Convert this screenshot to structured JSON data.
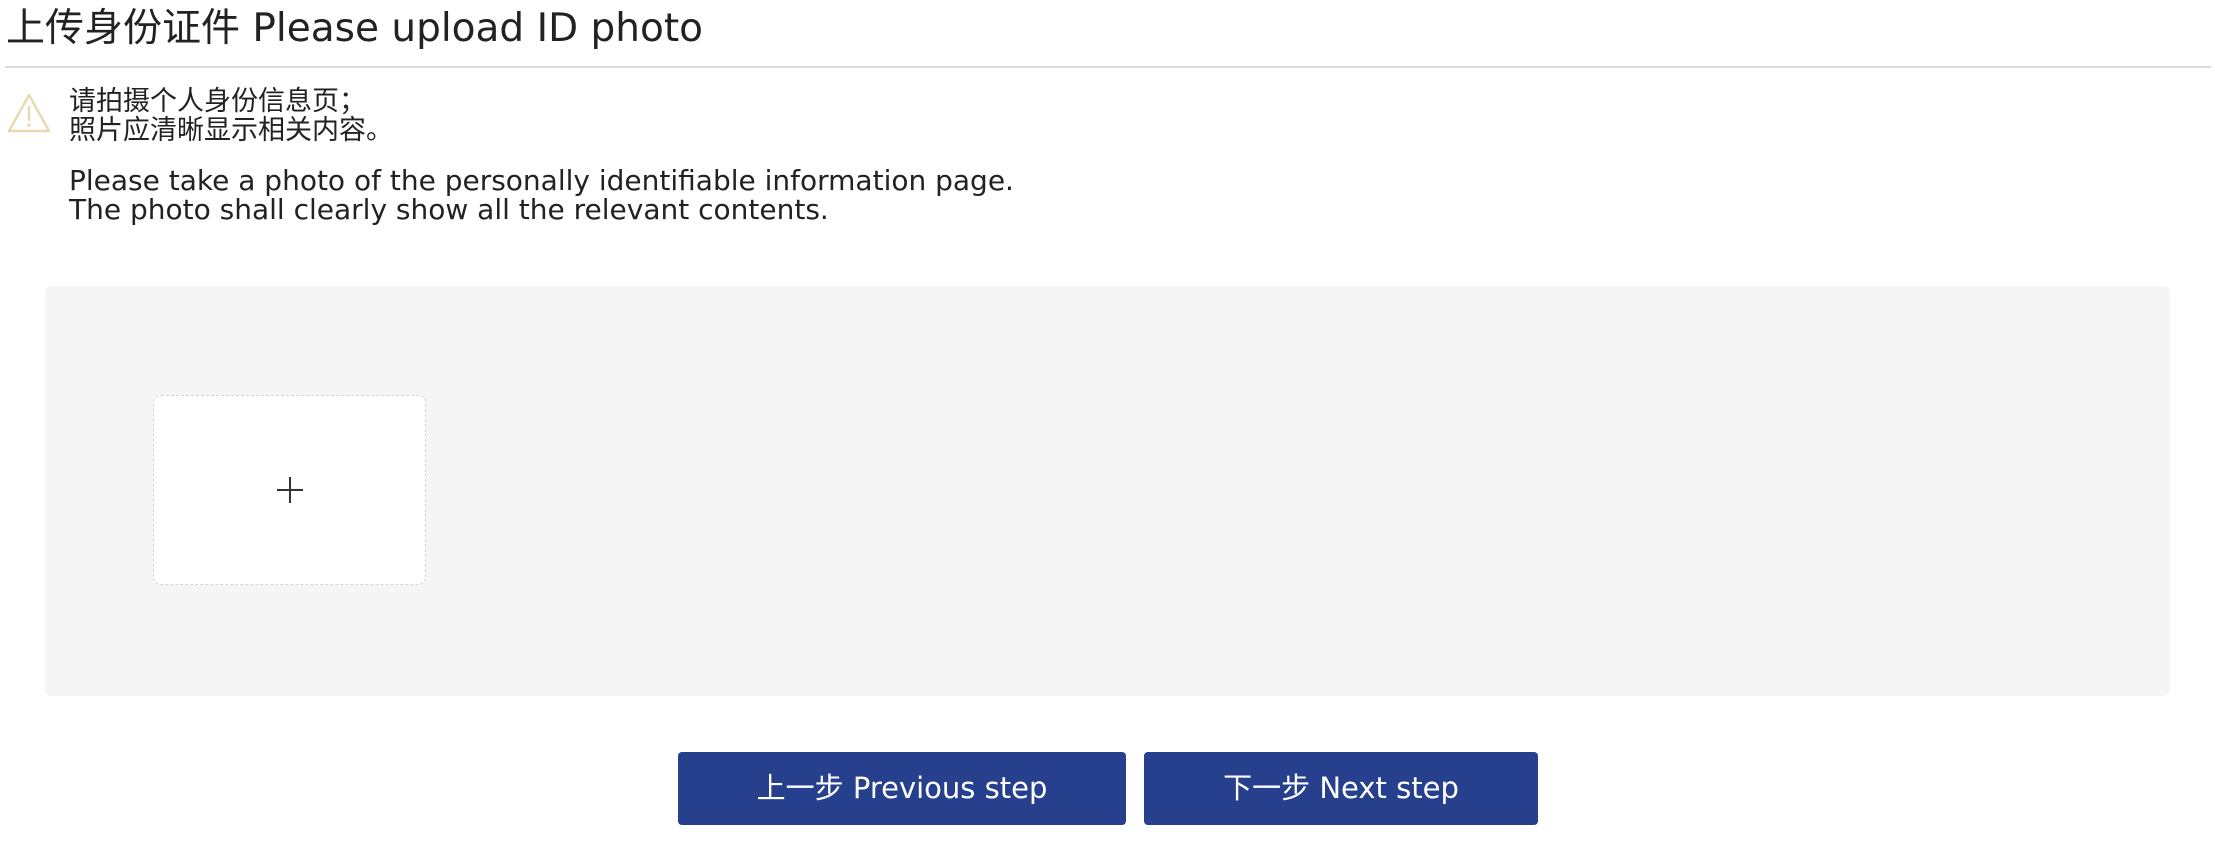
{
  "header": {
    "title": "上传身份证件 Please upload ID photo"
  },
  "notice": {
    "icon": "warning-triangle-icon",
    "icon_color": "#e7d9b1",
    "zh_lines": [
      "请拍摄个人身份信息页；",
      "照片应清晰显示相关内容。"
    ],
    "en_lines": [
      "Please take a photo of the personally identifiable information page.",
      "The photo shall clearly show all the relevant contents."
    ]
  },
  "upload": {
    "add_icon": "plus-icon",
    "panel_color": "#f5f5f5"
  },
  "actions": {
    "previous_label": "上一步 Previous step",
    "next_label": "下一步 Next step",
    "button_color": "#26408d"
  }
}
